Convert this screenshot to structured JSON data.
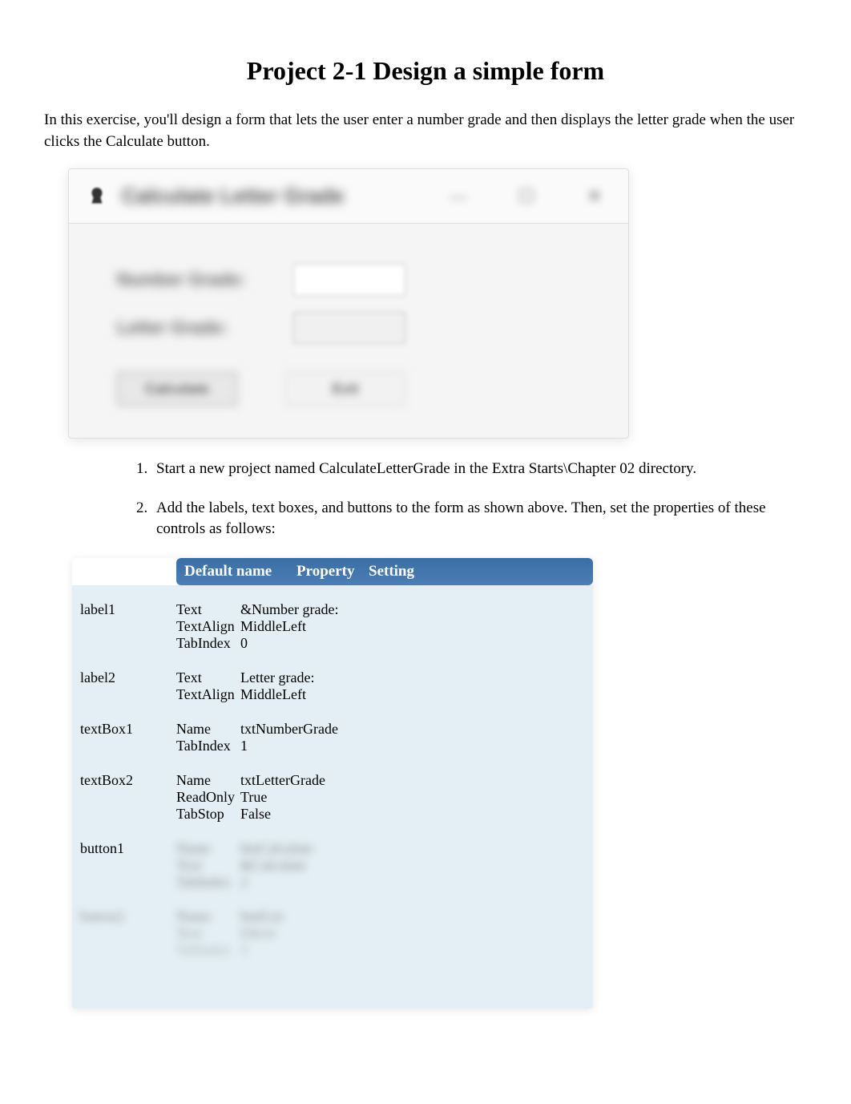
{
  "title": "Project 2-1 Design a simple form",
  "intro": "In this exercise, you'll design a form that lets the user enter a number grade and then displays the letter grade when the user clicks the Calculate button.",
  "form": {
    "window_title": "Calculate Letter Grade",
    "label_number": "Number Grade:",
    "label_letter": "Letter Grade:",
    "btn_calculate": "Calculate",
    "btn_exit": "Exit"
  },
  "steps": [
    {
      "num": "1.",
      "text": "Start a new project named CalculateLetterGrade in the Extra Starts\\Chapter 02 directory."
    },
    {
      "num": "2.",
      "text": "Add the labels, text boxes, and buttons to the form as shown above. Then, set the properties of these controls as follows:"
    }
  ],
  "prop_header": {
    "c1": "Default name",
    "c2": "Property",
    "c3": "Setting"
  },
  "props": [
    {
      "name": "label1",
      "rows": [
        {
          "prop": "Text",
          "val": "&Number grade:"
        },
        {
          "prop": "TextAlign",
          "val": "MiddleLeft"
        },
        {
          "prop": "TabIndex",
          "val": "0"
        }
      ]
    },
    {
      "name": "label2",
      "rows": [
        {
          "prop": "Text",
          "val": "Letter grade:"
        },
        {
          "prop": "TextAlign",
          "val": "MiddleLeft"
        }
      ]
    },
    {
      "name": "textBox1",
      "rows": [
        {
          "prop": "Name",
          "val": "txtNumberGrade"
        },
        {
          "prop": "TabIndex",
          "val": "1"
        }
      ]
    },
    {
      "name": "textBox2",
      "rows": [
        {
          "prop": "Name",
          "val": "txtLetterGrade"
        },
        {
          "prop": "ReadOnly",
          "val": "True"
        },
        {
          "prop": "TabStop",
          "val": "False"
        }
      ]
    },
    {
      "name": "button1",
      "rows": [
        {
          "prop": "Name",
          "val": "btnCalculate",
          "blur": true
        },
        {
          "prop": "Text",
          "val": "&Calculate",
          "blur": true
        },
        {
          "prop": "TabIndex",
          "val": "2",
          "blur": true
        }
      ]
    },
    {
      "name": "button2",
      "blur": true,
      "rows": [
        {
          "prop": "Name",
          "val": "btnExit",
          "blur": true
        },
        {
          "prop": "Text",
          "val": "E&xit",
          "blur": true
        },
        {
          "prop": "TabIndex",
          "val": "3",
          "blur": true
        }
      ]
    }
  ]
}
